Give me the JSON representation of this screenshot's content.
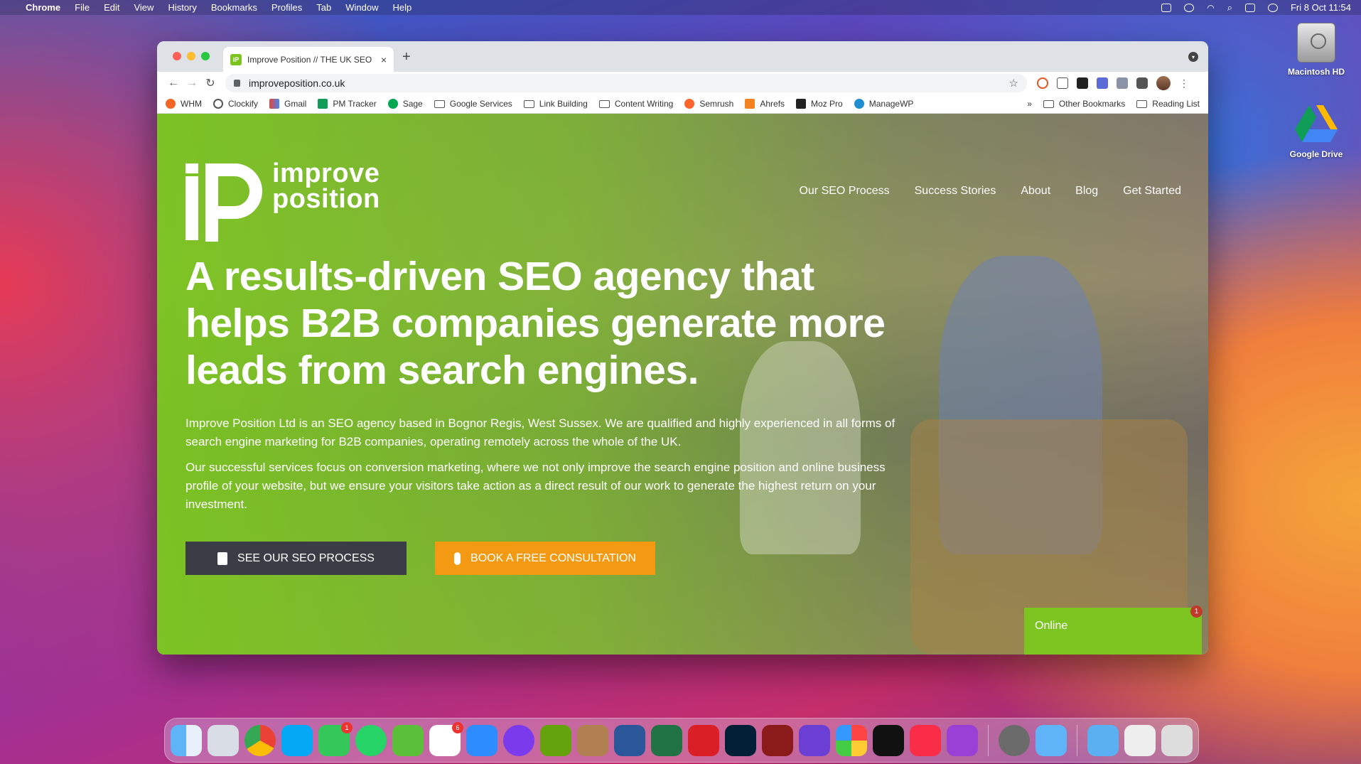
{
  "menubar": {
    "app_name": "Chrome",
    "menus": [
      "File",
      "Edit",
      "View",
      "History",
      "Bookmarks",
      "Profiles",
      "Tab",
      "Window",
      "Help"
    ],
    "clock": "Fri 8 Oct  11:54"
  },
  "desktop": {
    "icons": [
      {
        "label": "Macintosh HD",
        "icon": "hard-drive-icon"
      },
      {
        "label": "Google Drive",
        "icon": "google-drive-icon"
      }
    ]
  },
  "browser": {
    "tab_title": "Improve Position // THE UK SEO",
    "url": "improveposition.co.uk",
    "bookmarks": [
      "WHM",
      "Clockify",
      "Gmail",
      "PM Tracker",
      "Sage",
      "Google Services",
      "Link Building",
      "Content Writing",
      "Semrush",
      "Ahrefs",
      "Moz Pro",
      "ManageWP"
    ],
    "bookmarks_overflow": "»",
    "other_bookmarks": "Other Bookmarks",
    "reading_list": "Reading List"
  },
  "site": {
    "logo_text_line1": "improve",
    "logo_text_line2": "position",
    "nav": [
      "Our SEO Process",
      "Success Stories",
      "About",
      "Blog",
      "Get Started"
    ],
    "hero_title": "A results-driven SEO agency that helps B2B companies generate more leads from search engines.",
    "paragraph1": "Improve Position Ltd is an SEO agency based in Bognor Regis, West Sussex. We are qualified and highly experienced in all forms of search engine marketing for B2B companies, operating remotely across the whole of the UK.",
    "paragraph2": "Our successful services focus on conversion marketing, where we not only improve the search engine position and online business profile of your website, but we ensure your visitors take action as a direct result of our work to generate the highest return on your investment.",
    "cta_primary": "SEE OUR SEO PROCESS",
    "cta_secondary": "BOOK A FREE CONSULTATION",
    "chat_status": "Online",
    "chat_badge": "1"
  },
  "dock": {
    "badges": {
      "messages": "1",
      "slack": "6"
    }
  },
  "colors": {
    "brand_green": "#7cc520",
    "cta_orange": "#f39a12",
    "cta_dark": "#3a3d45"
  }
}
